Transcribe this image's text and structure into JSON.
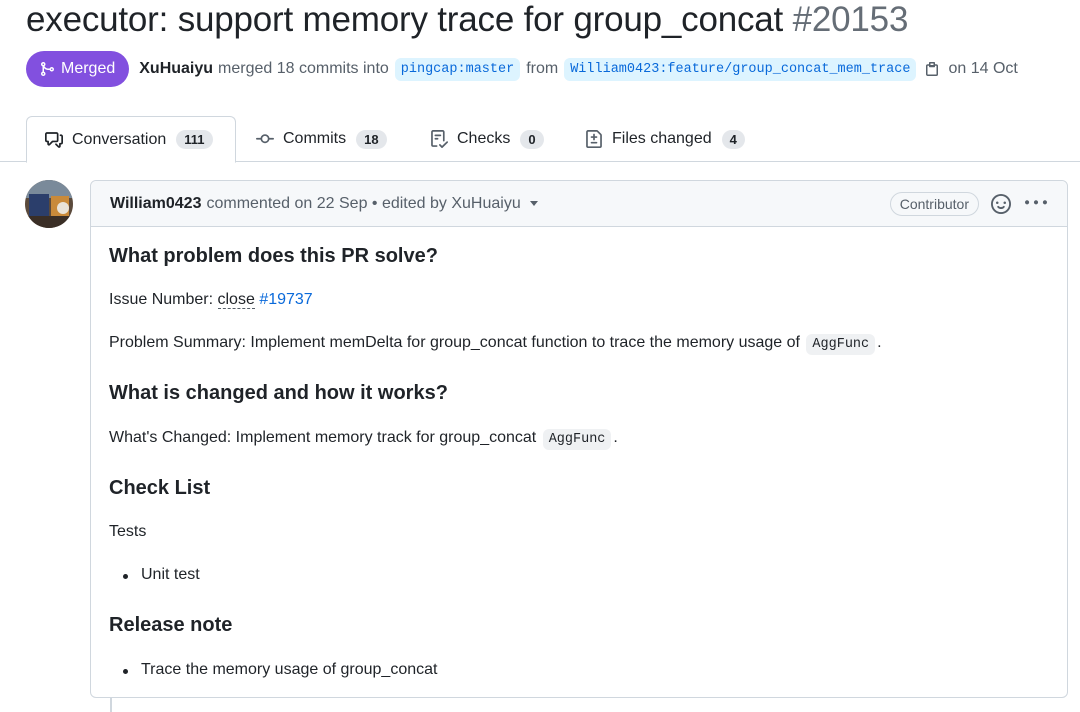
{
  "pr": {
    "title": "executor: support memory trace for group_concat",
    "number": "#20153",
    "state": "Merged",
    "merger": "XuHuaiyu",
    "merged_text": "merged 18 commits into",
    "base_branch": "pingcap:master",
    "from_text": "from",
    "head_branch": "William0423:feature/group_concat_mem_trace",
    "date_text": "on 14 Oct"
  },
  "tabs": [
    {
      "label": "Conversation",
      "count": "111",
      "icon": "comment-discussion-icon"
    },
    {
      "label": "Commits",
      "count": "18",
      "icon": "git-commit-icon"
    },
    {
      "label": "Checks",
      "count": "0",
      "icon": "checklist-icon"
    },
    {
      "label": "Files changed",
      "count": "4",
      "icon": "file-diff-icon"
    }
  ],
  "comment": {
    "author": "William0423",
    "meta": "commented on 22 Sep • edited by XuHuaiyu",
    "role": "Contributor",
    "h1": "What problem does this PR solve?",
    "issue_label": "Issue Number:",
    "issue_close": "close",
    "issue_link": "#19737",
    "summary_prefix": "Problem Summary: Implement memDelta for group_concat function to trace the memory usage of",
    "summary_code": "AggFunc",
    "summary_suffix": ".",
    "h2": "What is changed and how it works?",
    "changed_prefix": "What's Changed: Implement memory track for group_concat",
    "changed_code": "AggFunc",
    "changed_suffix": ".",
    "h3": "Check List",
    "tests_label": "Tests",
    "tests_item": "Unit test",
    "h4": "Release note",
    "release_item": "Trace the memory usage of group_concat"
  },
  "colors": {
    "merged": "#8250df",
    "link": "#0969da",
    "border": "#d0d7de"
  }
}
